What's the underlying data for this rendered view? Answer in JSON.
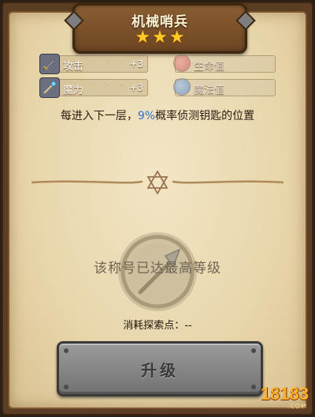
{
  "title": "机械哨兵",
  "stars": [
    "★",
    "★",
    "★"
  ],
  "stats": {
    "attack": {
      "label": "攻击",
      "value": "+3",
      "icon": "sword-icon"
    },
    "magic": {
      "label": "魔力",
      "value": "+3",
      "icon": "staff-icon"
    },
    "hp": {
      "label": "生命值",
      "icon": "red-potion-icon"
    },
    "mp": {
      "label": "魔法值",
      "icon": "blue-potion-icon"
    }
  },
  "description": {
    "before": "每进入下一层，",
    "highlight": "9%",
    "after": "概率侦测钥匙的位置"
  },
  "status_text": "该称号已达最高等级",
  "cost": {
    "label": "消耗探索点：",
    "value": "--"
  },
  "upgrade_button": {
    "label": "升级"
  },
  "watermark": {
    "text": "18183",
    "sub": ".COM"
  },
  "colors": {
    "highlight": "#2e6ed8",
    "star": "#ffc928",
    "parchment": "#ecdcb3"
  }
}
